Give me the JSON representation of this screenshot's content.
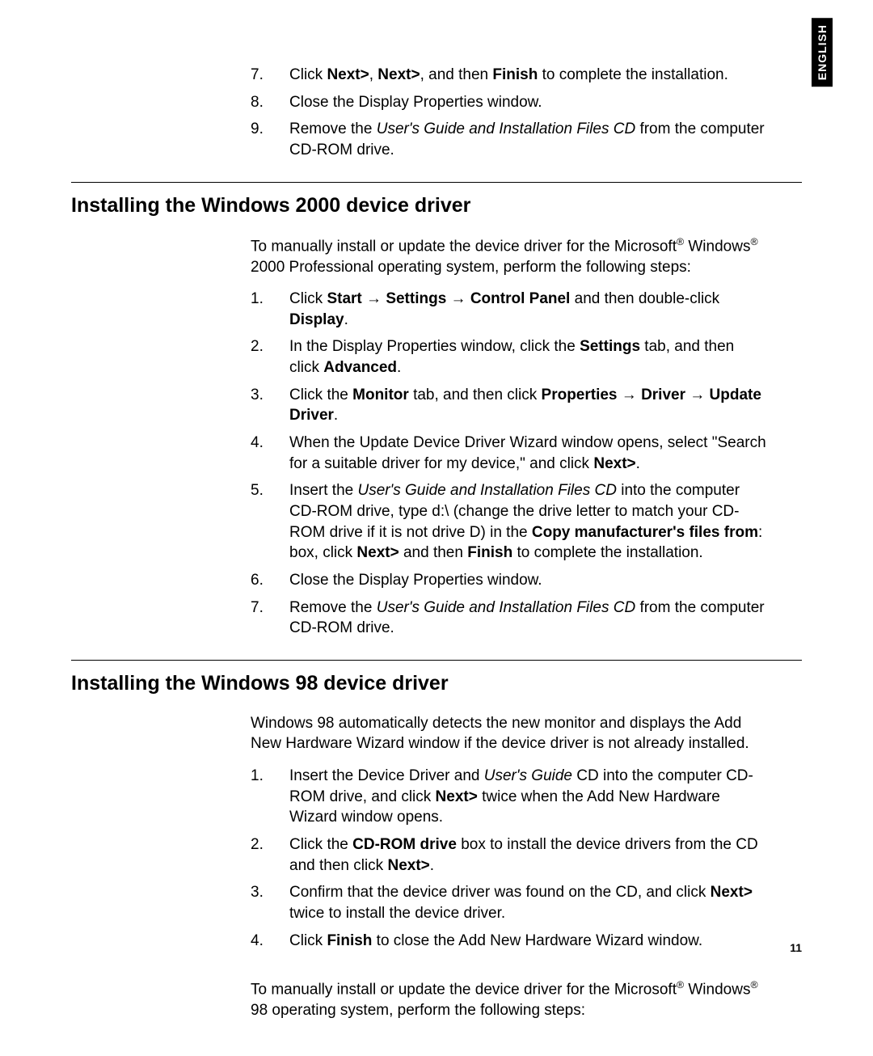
{
  "language_tab": "ENGLISH",
  "page_number": "11",
  "top_list": {
    "start": 7,
    "items": [
      "Click <b>Next></b>, <b>Next></b>, and then <b>Finish</b> to complete the installation.",
      "Close the Display Properties window.",
      "Remove the <i>User's Guide and Installation Files CD</i> from the computer CD-ROM drive."
    ]
  },
  "section_2000": {
    "heading": "Installing the Windows 2000 device driver",
    "intro": "To manually install or update the device driver for the Microsoft<sup>®</sup> Windows<sup>®</sup> 2000 Professional operating system, perform the following steps:",
    "items": [
      "Click <b>Start</b> → <b>Settings</b> → <b>Control Panel</b> and then double-click <b>Display</b>.",
      "In the Display Properties window, click the <b>Settings</b> tab, and then click <b>Advanced</b>.",
      "Click the <b>Monitor</b> tab, and then click <b>Properties</b> → <b>Driver</b> → <b>Update Driver</b>.",
      "When the Update Device Driver Wizard window opens, select \"Search for a suitable driver for my device,\" and click <b>Next></b>.",
      "Insert the <i>User's Guide and Installation Files CD</i> into the computer CD-ROM drive, type d:\\ (change the drive letter to match your CD-ROM drive if it is not drive D) in the <b>Copy manufacturer's files from</b>: box, click <b>Next></b> and then <b>Finish</b> to complete the installation.",
      "Close the Display Properties window.",
      "Remove the <i>User's Guide and Installation Files CD</i> from the computer CD-ROM drive."
    ]
  },
  "section_98": {
    "heading": "Installing the Windows 98 device driver",
    "intro": "Windows 98 automatically detects the new monitor and displays the Add New Hardware Wizard window if the device driver is not already installed.",
    "items": [
      "Insert the Device Driver and <i>User's Guide</i> CD into the computer CD-ROM drive, and click <b>Next></b> twice when the Add New Hardware Wizard window opens.",
      "Click the <b>CD-ROM drive</b> box to install the device drivers from the CD and then click <b>Next></b>.",
      "Confirm that the device driver was found on the CD, and click <b>Next></b> twice to install the device driver.",
      "Click <b>Finish</b> to close the Add New Hardware Wizard window."
    ],
    "outro": "To manually install or update the device driver for the Microsoft<sup>®</sup> Windows<sup>®</sup> 98 operating system, perform the following steps:"
  }
}
